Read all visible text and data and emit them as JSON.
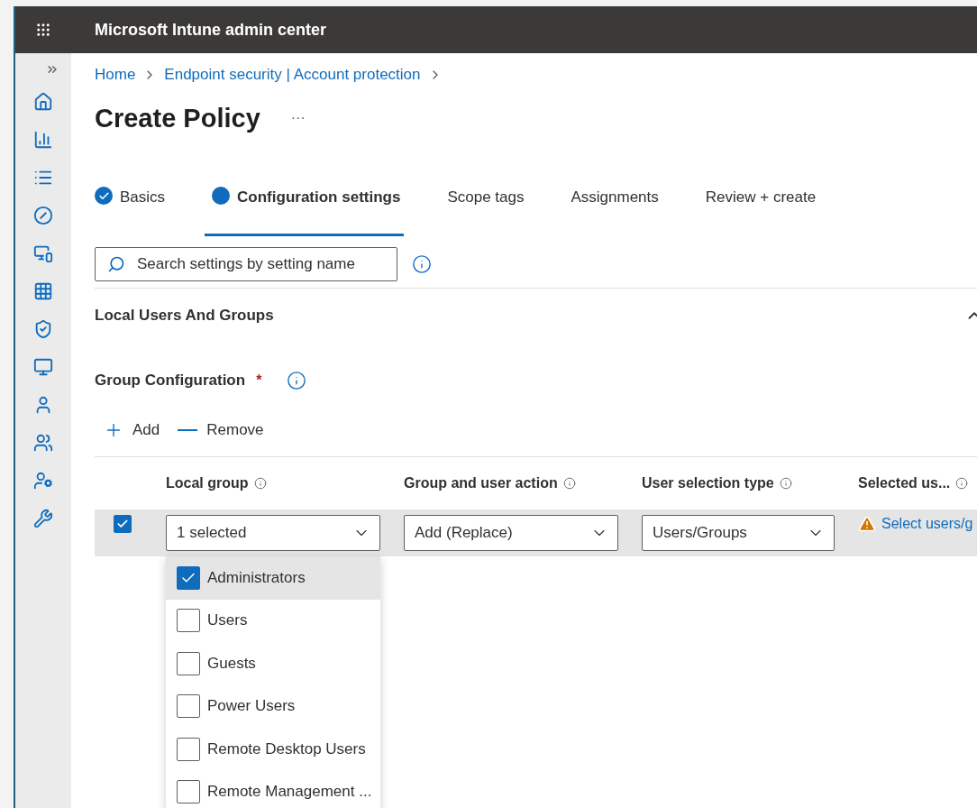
{
  "app_bar": {
    "title": "Microsoft Intune admin center"
  },
  "breadcrumb": [
    "Home",
    "Endpoint security | Account protection"
  ],
  "page_title": "Create Policy",
  "more": "···",
  "tabs": [
    {
      "label": "Basics",
      "selected": false,
      "kind": "done"
    },
    {
      "label": "Configuration settings",
      "selected": true,
      "kind": "current"
    },
    {
      "label": "Scope tags",
      "selected": false,
      "kind": "plain"
    },
    {
      "label": "Assignments",
      "selected": false,
      "kind": "plain"
    },
    {
      "label": "Review + create",
      "selected": false,
      "kind": "plain"
    }
  ],
  "search": {
    "placeholder": "Search settings by setting name"
  },
  "section": {
    "title": "Local Users And Groups",
    "expanded": true
  },
  "group": {
    "label": "Group Configuration",
    "required": "*"
  },
  "toolbar": [
    "Add",
    "Remove"
  ],
  "table": {
    "columns": [
      "Local group",
      "Group and user action",
      "User selection type",
      "Selected us..."
    ],
    "rows": [
      {
        "checked": true,
        "local_group": "1 selected",
        "action": "Add (Replace)",
        "selection_type": "Users/Groups",
        "selected_users": "Select users/g"
      }
    ]
  },
  "dropdown": {
    "options": [
      {
        "label": "Administrators",
        "checked": true,
        "highlighted": true
      },
      {
        "label": "Users",
        "checked": false,
        "highlighted": false
      },
      {
        "label": "Guests",
        "checked": false,
        "highlighted": false
      },
      {
        "label": "Power Users",
        "checked": false,
        "highlighted": false
      },
      {
        "label": "Remote Desktop Users",
        "checked": false,
        "highlighted": false
      },
      {
        "label": "Remote Management ...",
        "checked": false,
        "highlighted": false
      }
    ]
  }
}
